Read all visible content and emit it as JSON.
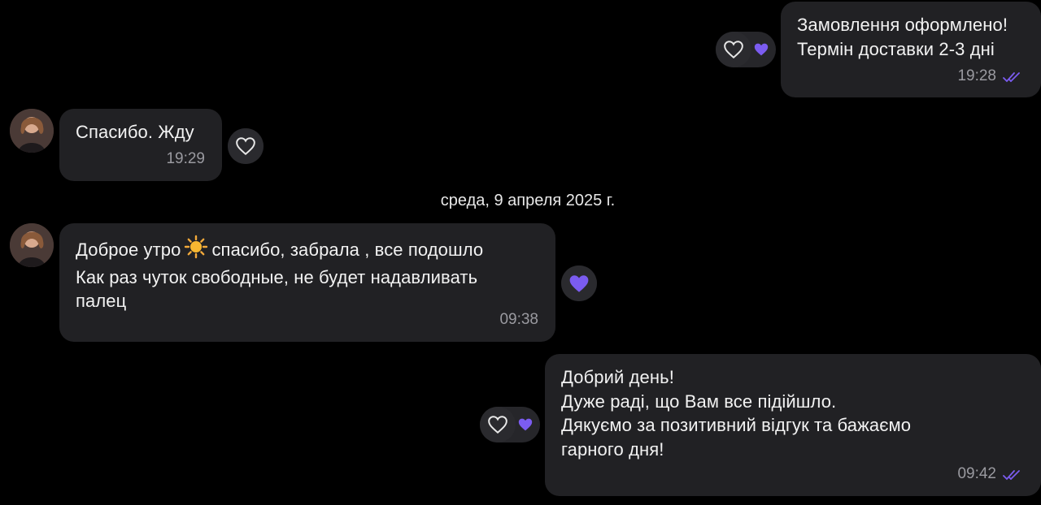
{
  "messages": [
    {
      "id": "m1",
      "direction": "outgoing",
      "text": "Замовлення оформлено!\nТермін доставки 2-3 дні",
      "time": "19:28",
      "status": "read",
      "reactions": [
        "heart-outline",
        "heart-filled"
      ]
    },
    {
      "id": "m2",
      "direction": "incoming",
      "text": "Спасибо. Жду",
      "time": "19:29",
      "reactions": [
        "heart-outline"
      ]
    },
    {
      "id": "m3",
      "direction": "incoming",
      "text_part1": "Доброе утро",
      "emoji": "sun",
      "text_part2": "спасибо, забрала , все подошло\nКак раз чуток свободные, не будет надавливать\nпалец",
      "time": "09:38",
      "reactions": [
        "heart-filled"
      ]
    },
    {
      "id": "m4",
      "direction": "outgoing",
      "text": "Добрий день!\nДуже раді, що Вам все підійшло.\nДякуємо за позитивний відгук та бажаємо\nгарного дня!",
      "time": "09:42",
      "status": "read",
      "reactions": [
        "heart-outline",
        "heart-filled"
      ]
    }
  ],
  "date_separator": "среда, 9 апреля 2025 г.",
  "colors": {
    "background": "#000000",
    "bubble": "#212124",
    "accent_purple": "#7b5cf0",
    "timestamp": "#9a9aa0"
  }
}
